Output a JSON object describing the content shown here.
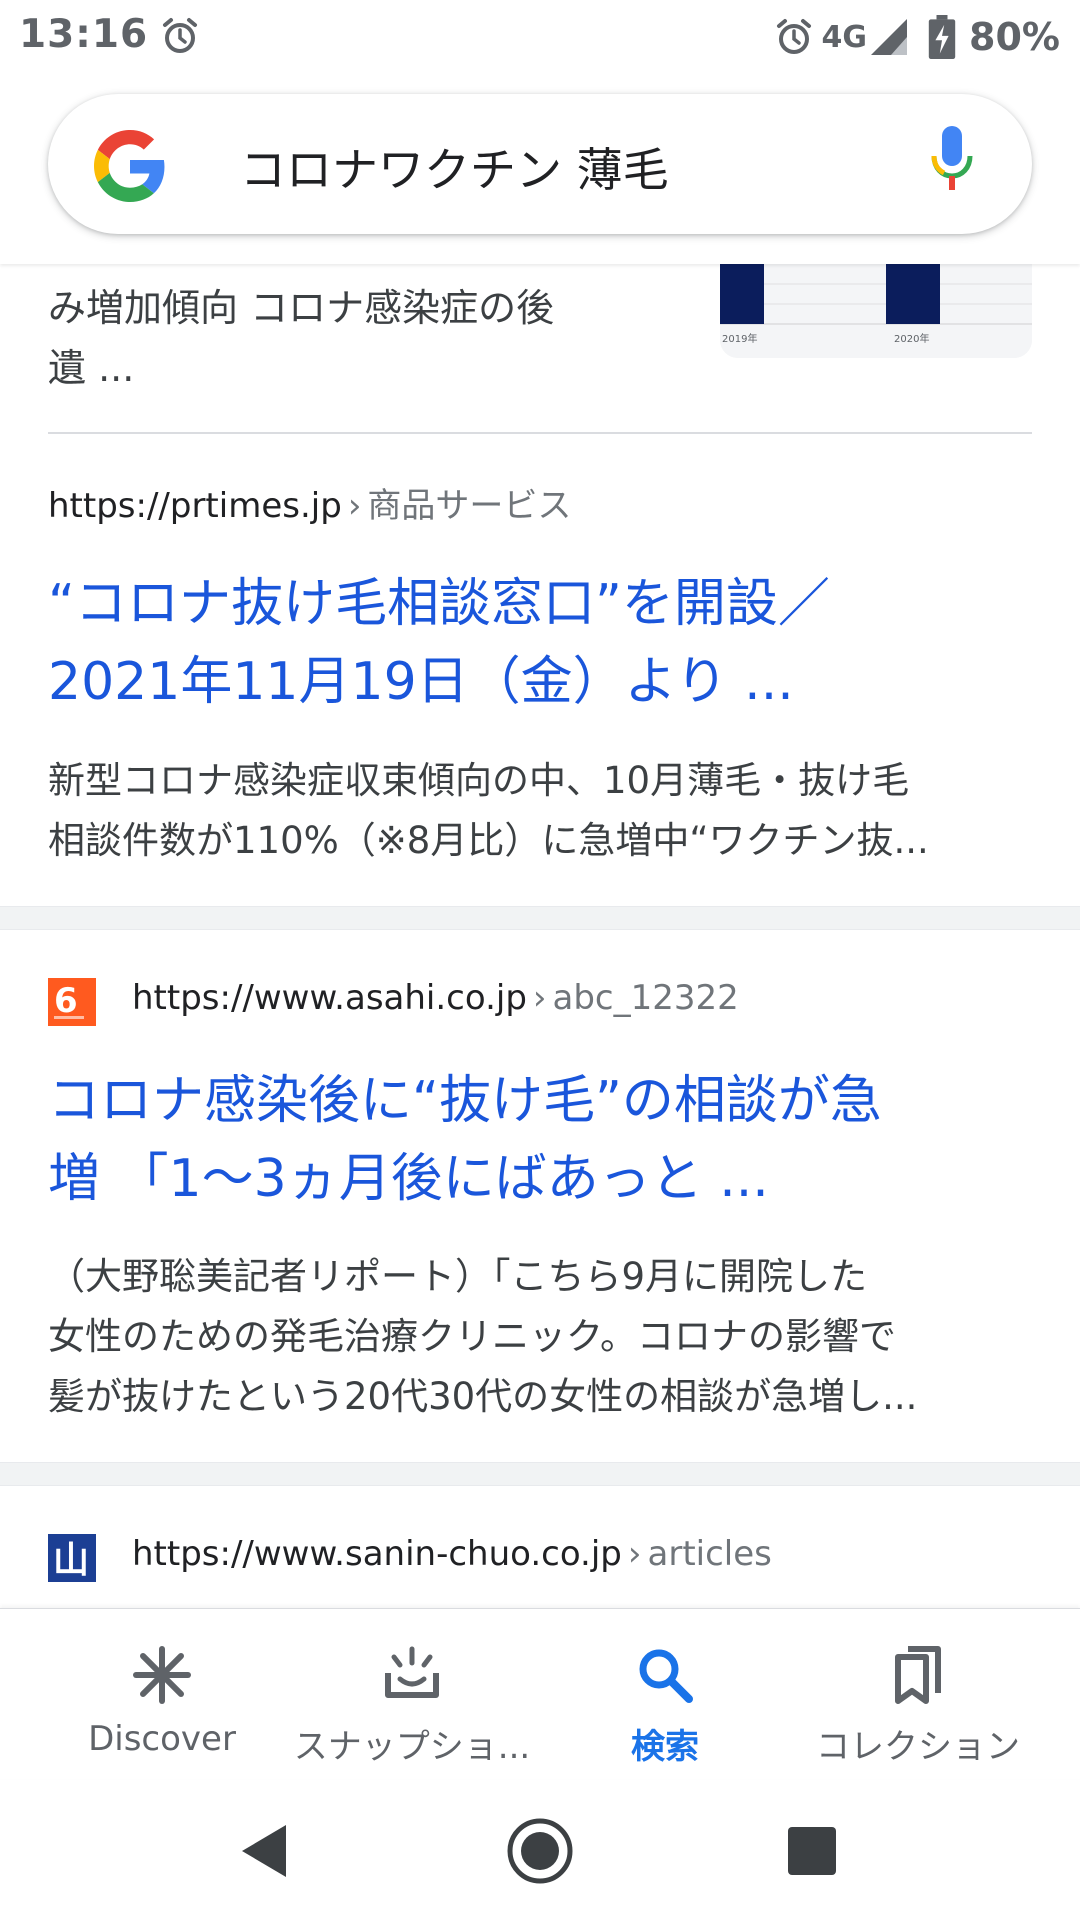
{
  "status_bar": {
    "time": "13:16",
    "network": "4G",
    "battery": "80%",
    "icons": [
      "alarm-icon",
      "alarm-icon",
      "signal-icon",
      "battery-charging-icon"
    ]
  },
  "search": {
    "query": "コロナワクチン 薄毛",
    "logo": "google-logo",
    "voice_icon": "mic-icon"
  },
  "results": {
    "partial": {
      "snippet_lines": [
        "み増加傾向 コロナ感染症の後",
        "遺 ..."
      ],
      "thumb_labels": [
        "2019年",
        "2020年"
      ]
    },
    "items": [
      {
        "domain": "https://prtimes.jp",
        "breadcrumb": "商品サービス",
        "title_lines": [
          "“コロナ抜け毛相談窓口”を開設／",
          "2021年11月19日（金）より ..."
        ],
        "snippet_lines": [
          "新型コロナ感染症収束傾向の中、10月薄毛・抜け毛",
          "相談件数が110%（※8月比）に急増中“ワクチン抜..."
        ]
      },
      {
        "domain": "https://www.asahi.co.jp",
        "breadcrumb": "abc_12322",
        "favicon_text": "6",
        "title_lines": [
          "コロナ感染後に“抜け毛”の相談が急",
          "増 「1〜3ヵ月後にばあっと ..."
        ],
        "snippet_lines": [
          "（大野聡美記者リポート）「こちら9月に開院した",
          "女性のための発毛治療クリニック。コロナの影響で",
          "髪が抜けたという20代30代の女性の相談が急増し..."
        ]
      },
      {
        "domain": "https://www.sanin-chuo.co.jp",
        "breadcrumb": "articles",
        "favicon_text": "山"
      }
    ],
    "separator": "›"
  },
  "bottom_nav": {
    "items": [
      {
        "label": "Discover",
        "icon": "asterisk-icon",
        "active": false
      },
      {
        "label": "スナップショ...",
        "icon": "snapshot-icon",
        "active": false
      },
      {
        "label": "検索",
        "icon": "search-icon",
        "active": true
      },
      {
        "label": "コレクション",
        "icon": "collections-icon",
        "active": false
      }
    ]
  },
  "colors": {
    "link": "#1a56db",
    "active": "#1a73e8",
    "text": "#202124",
    "muted": "#70757a"
  }
}
